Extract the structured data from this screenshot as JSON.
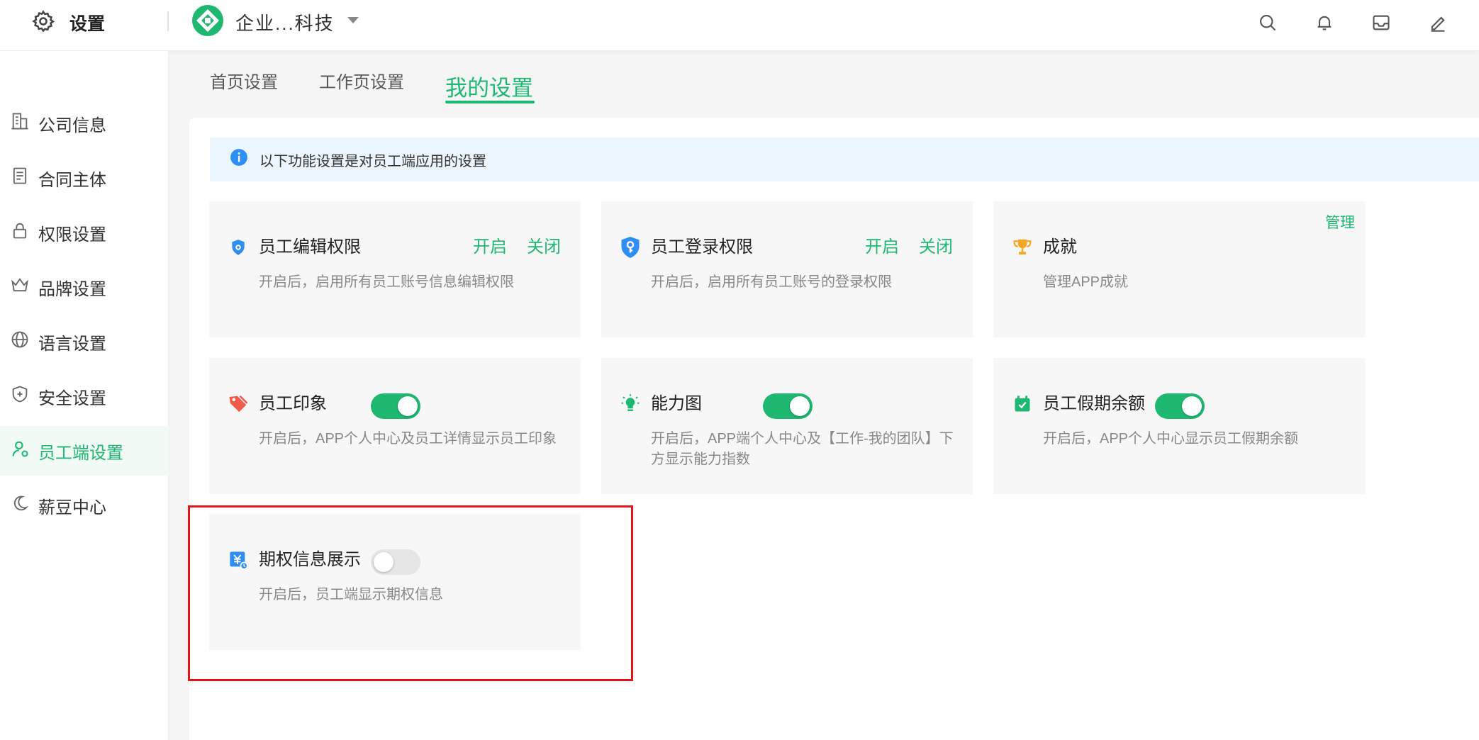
{
  "header": {
    "title": "设置",
    "company_name": "企业...科技"
  },
  "sidebar": {
    "items": [
      {
        "label": "公司信息",
        "icon": "building-icon"
      },
      {
        "label": "合同主体",
        "icon": "document-icon"
      },
      {
        "label": "权限设置",
        "icon": "lock-icon"
      },
      {
        "label": "品牌设置",
        "icon": "crown-icon"
      },
      {
        "label": "语言设置",
        "icon": "globe-icon"
      },
      {
        "label": "安全设置",
        "icon": "shield-icon"
      },
      {
        "label": "员工端设置",
        "icon": "user-icon",
        "active": true
      },
      {
        "label": "薪豆中心",
        "icon": "bean-icon"
      }
    ]
  },
  "tabs": [
    {
      "label": "首页设置"
    },
    {
      "label": "工作页设置"
    },
    {
      "label": "我的设置",
      "active": true
    }
  ],
  "info": {
    "text": "以下功能设置是对员工端应用的设置"
  },
  "cards": [
    {
      "title": "员工编辑权限",
      "desc": "开启后，启用所有员工账号信息编辑权限",
      "on_label": "开启",
      "off_label": "关闭"
    },
    {
      "title": "员工登录权限",
      "desc": "开启后，启用所有员工账号的登录权限",
      "on_label": "开启",
      "off_label": "关闭"
    },
    {
      "title": "成就",
      "desc": "管理APP成就",
      "manage_label": "管理"
    },
    {
      "title": "员工印象",
      "desc": "开启后，APP个人中心及员工详情显示员工印象",
      "toggle": 1
    },
    {
      "title": "能力图",
      "desc": "开启后，APP端个人中心及【工作-我的团队】下方显示能力指数",
      "toggle": 1
    },
    {
      "title": "员工假期余额",
      "desc": "开启后，APP个人中心显示员工假期余额",
      "toggle": 1
    },
    {
      "title": "期权信息展示",
      "desc": "开启后，员工端显示期权信息",
      "toggle": 0
    }
  ],
  "colors": {
    "accent": "#1eb872",
    "highlight": "#e5131a",
    "info_bg": "#eaf5fd"
  }
}
